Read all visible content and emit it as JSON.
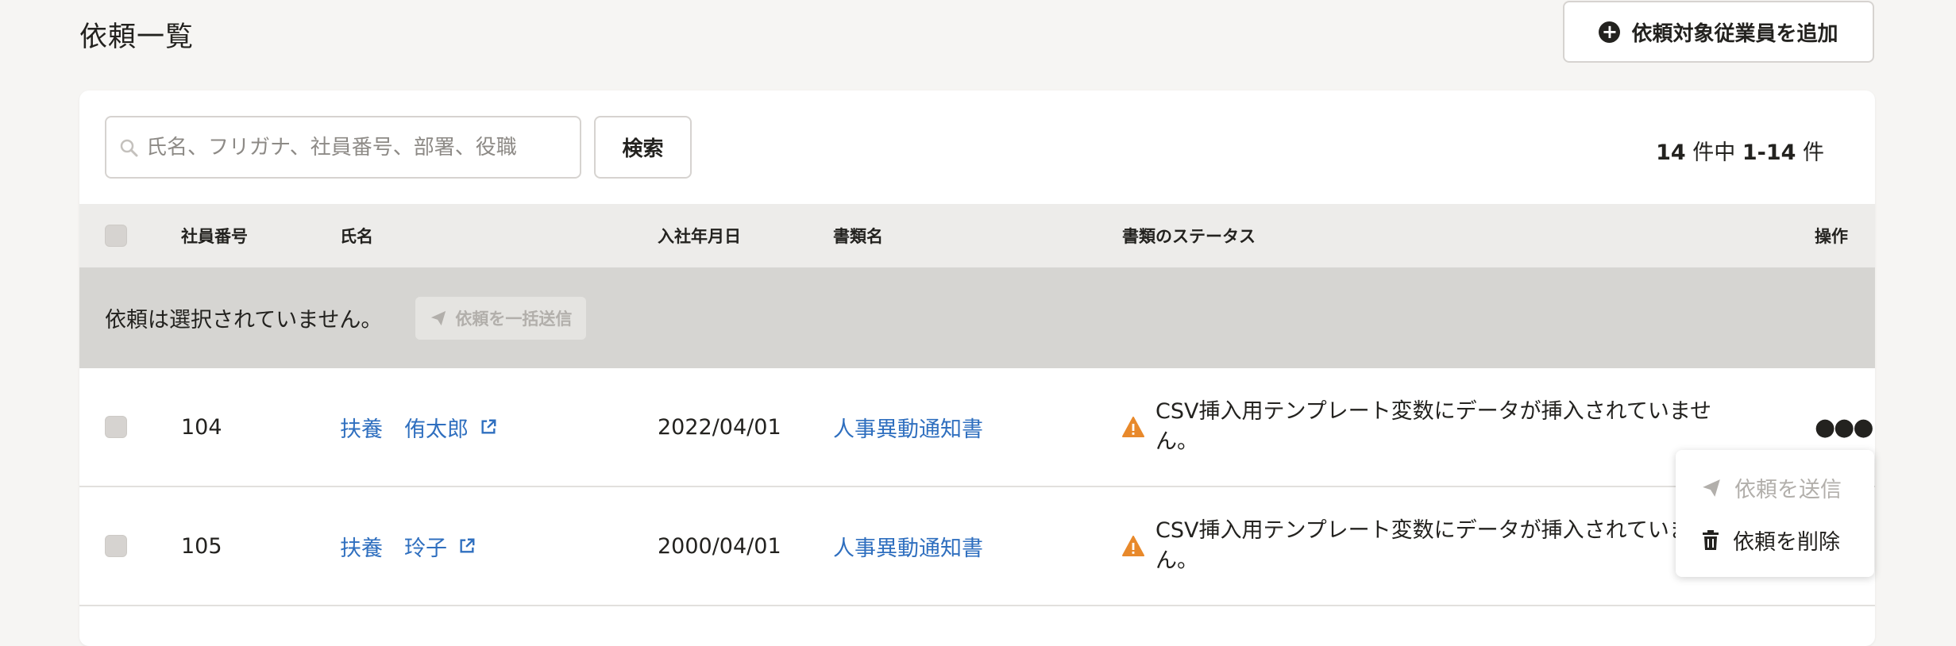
{
  "page": {
    "title": "依頼一覧"
  },
  "add_button": {
    "label": "依頼対象従業員を追加",
    "icon": "plus-circle-icon"
  },
  "search": {
    "placeholder": "氏名、フリガナ、社員番号、部署、役職",
    "button_label": "検索"
  },
  "pagination": {
    "total": "14",
    "total_suffix": " 件中 ",
    "range": "1-14",
    "range_suffix": " 件"
  },
  "table": {
    "headers": [
      "社員番号",
      "氏名",
      "入社年月日",
      "書類名",
      "書類のステータス",
      "操作"
    ],
    "rows": [
      {
        "employee_id": "104",
        "name": "扶養　侑太郎",
        "hire_date": "2022/04/01",
        "document": "人事異動通知書",
        "status": "CSV挿入用テンプレート変数にデータが挿入されていません。"
      },
      {
        "employee_id": "105",
        "name": "扶養　玲子",
        "hire_date": "2000/04/01",
        "document": "人事異動通知書",
        "status": "CSV挿入用テンプレート変数にデータが挿入されていません。"
      }
    ]
  },
  "bulk": {
    "message": "依頼は選択されていません。",
    "button_label": "依頼を一括送信"
  },
  "menu": {
    "send_label": "依頼を送信",
    "delete_label": "依頼を削除"
  },
  "colors": {
    "link": "#2f6fbf",
    "warning": "#e8892b",
    "header_bg": "#edecea",
    "bulk_bg": "#d6d5d2"
  }
}
